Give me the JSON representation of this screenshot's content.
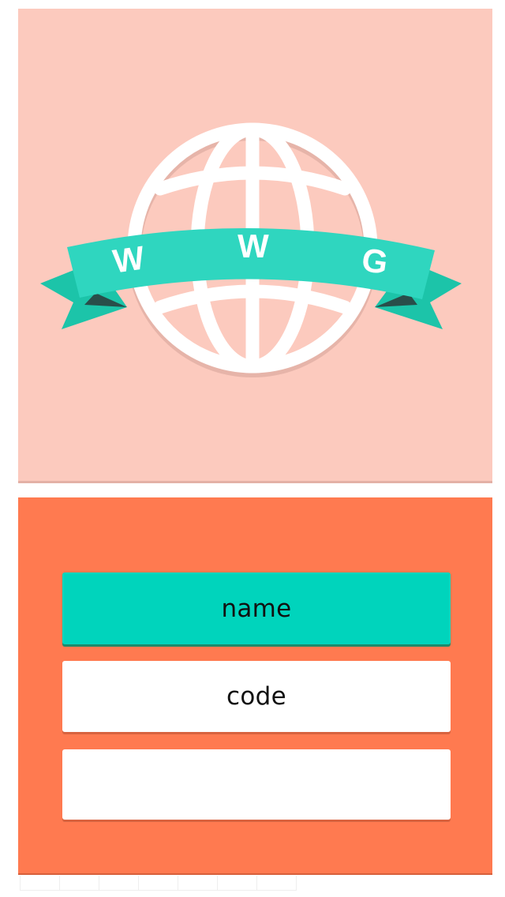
{
  "logo": {
    "letters": [
      "W",
      "W",
      "G"
    ],
    "icon": "globe-icon"
  },
  "form": {
    "name_label": "name",
    "code_label": "code",
    "third_label": ""
  },
  "colors": {
    "logo_background": "#fccabe",
    "form_background": "#ff7a50",
    "accent": "#00d4bc",
    "ribbon": "#2dd4be",
    "globe": "#ffffff"
  }
}
